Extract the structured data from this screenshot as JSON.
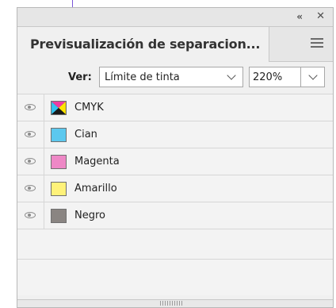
{
  "titlebar": {
    "collapse_glyph": "«",
    "close_glyph": "✕"
  },
  "panel": {
    "title": "Previsualización de separacion..."
  },
  "view": {
    "label": "Ver:",
    "selected": "Límite de tinta",
    "ink_limit": "220%"
  },
  "separations": [
    {
      "name": "CMYK",
      "swatch": "cmyk"
    },
    {
      "name": "Cian",
      "swatch": "#5cc8ee"
    },
    {
      "name": "Magenta",
      "swatch": "#ee88c6"
    },
    {
      "name": "Amarillo",
      "swatch": "#fff27a"
    },
    {
      "name": "Negro",
      "swatch": "#8a8582"
    }
  ]
}
